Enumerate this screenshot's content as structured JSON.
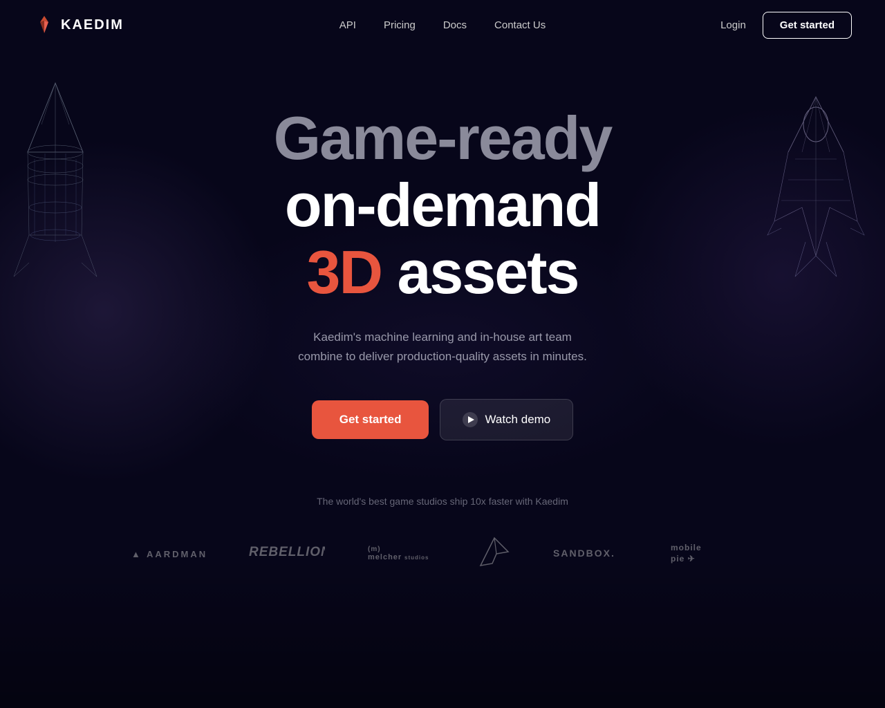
{
  "nav": {
    "logo_text": "KAEDIM",
    "links": [
      {
        "label": "API",
        "id": "api"
      },
      {
        "label": "Pricing",
        "id": "pricing"
      },
      {
        "label": "Docs",
        "id": "docs"
      },
      {
        "label": "Contact Us",
        "id": "contact"
      }
    ],
    "login_label": "Login",
    "get_started_label": "Get started"
  },
  "hero": {
    "line1": "Game-ready",
    "line2": "on-demand",
    "line3_accent": "3D",
    "line3_normal": " assets",
    "subtitle_line1": "Kaedim's machine learning and in-house art team",
    "subtitle_line2": "combine to deliver production-quality assets in minutes.",
    "get_started_label": "Get started",
    "watch_demo_label": "Watch demo"
  },
  "logos": {
    "tagline": "The world's best game studios ship 10x faster with Kaedim",
    "companies": [
      {
        "name": "AARDMAN",
        "css_class": "logo-aardman",
        "id": "aardman"
      },
      {
        "name": "REBELLION",
        "css_class": "logo-rebellion",
        "id": "rebellion"
      },
      {
        "name": "(m) melcher",
        "css_class": "logo-melcher",
        "id": "melcher"
      },
      {
        "name": "✈",
        "css_class": "logo-paperplane",
        "id": "paperplane"
      },
      {
        "name": "SANDBOX.",
        "css_class": "logo-sandbox",
        "id": "sandbox"
      },
      {
        "name": "mobile pie ✈",
        "css_class": "logo-mobilepie",
        "id": "mobilepie"
      }
    ]
  },
  "colors": {
    "accent_red": "#e8553e",
    "bg_dark": "#07061a",
    "text_muted": "#9999aa",
    "text_faint": "#666677"
  }
}
